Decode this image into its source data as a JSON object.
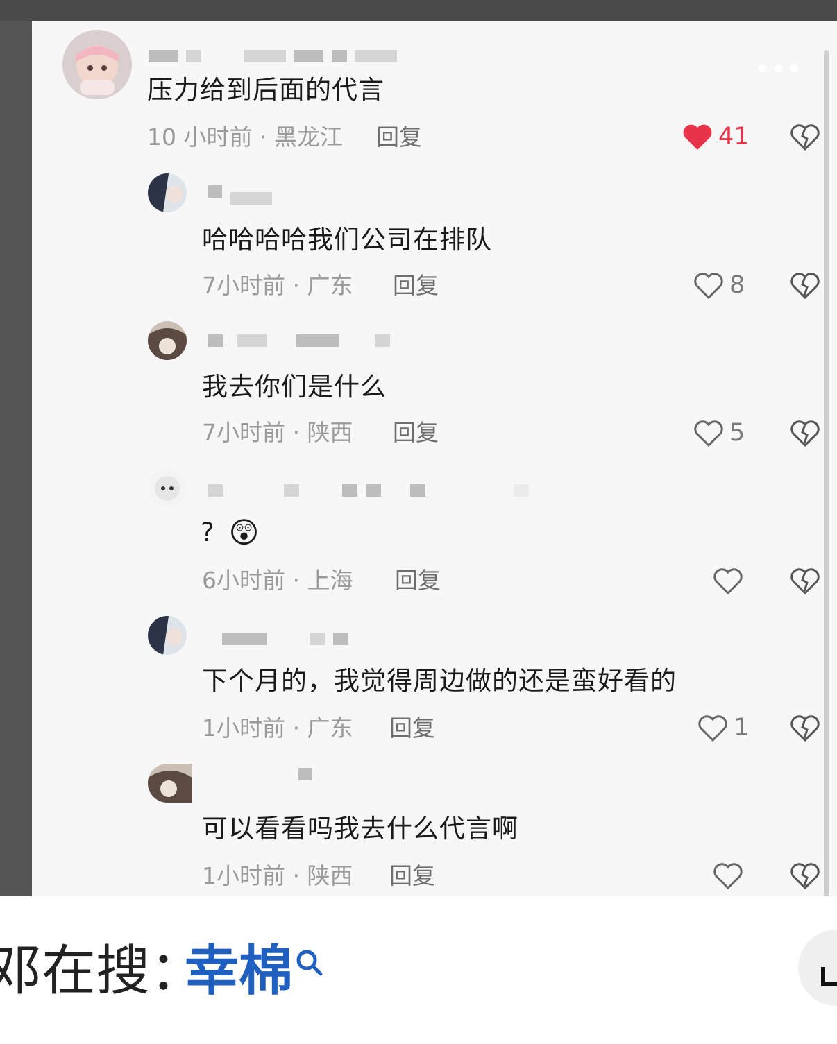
{
  "colors": {
    "accent_like": "#e8344a",
    "search_link": "#1f5fbf",
    "meta_gray": "#9a9a9a"
  },
  "comment_main": {
    "text": "压力给到后面的代言",
    "meta": "10 小时前 · 黑龙江",
    "reply": "回复",
    "likes": "41",
    "liked": true
  },
  "replies": [
    {
      "text": "哈哈哈哈我们公司在排队",
      "meta": "7小时前 · 广东",
      "reply": "回复",
      "likes": "8"
    },
    {
      "text": "我去你们是什么",
      "meta": "7小时前 · 陕西",
      "reply": "回复",
      "likes": "5"
    },
    {
      "text": "?",
      "emoji": "😲",
      "meta": "6小时前 · 上海",
      "reply": "回复",
      "likes": ""
    },
    {
      "text": "下个月的，我觉得周边做的还是蛮好看的",
      "meta": "1小时前 · 广东",
      "reply": "回复",
      "likes": "1"
    },
    {
      "text": "可以看看吗我去什么代言啊",
      "meta": "1小时前 · 陕西",
      "reply": "回复",
      "likes": ""
    }
  ],
  "search_bar": {
    "prefix": "邓在搜：",
    "term": "幸棉"
  },
  "icons": {
    "like": "heart-icon",
    "dislike": "broken-heart-icon",
    "more": "more-dots-icon",
    "search": "search-icon"
  }
}
